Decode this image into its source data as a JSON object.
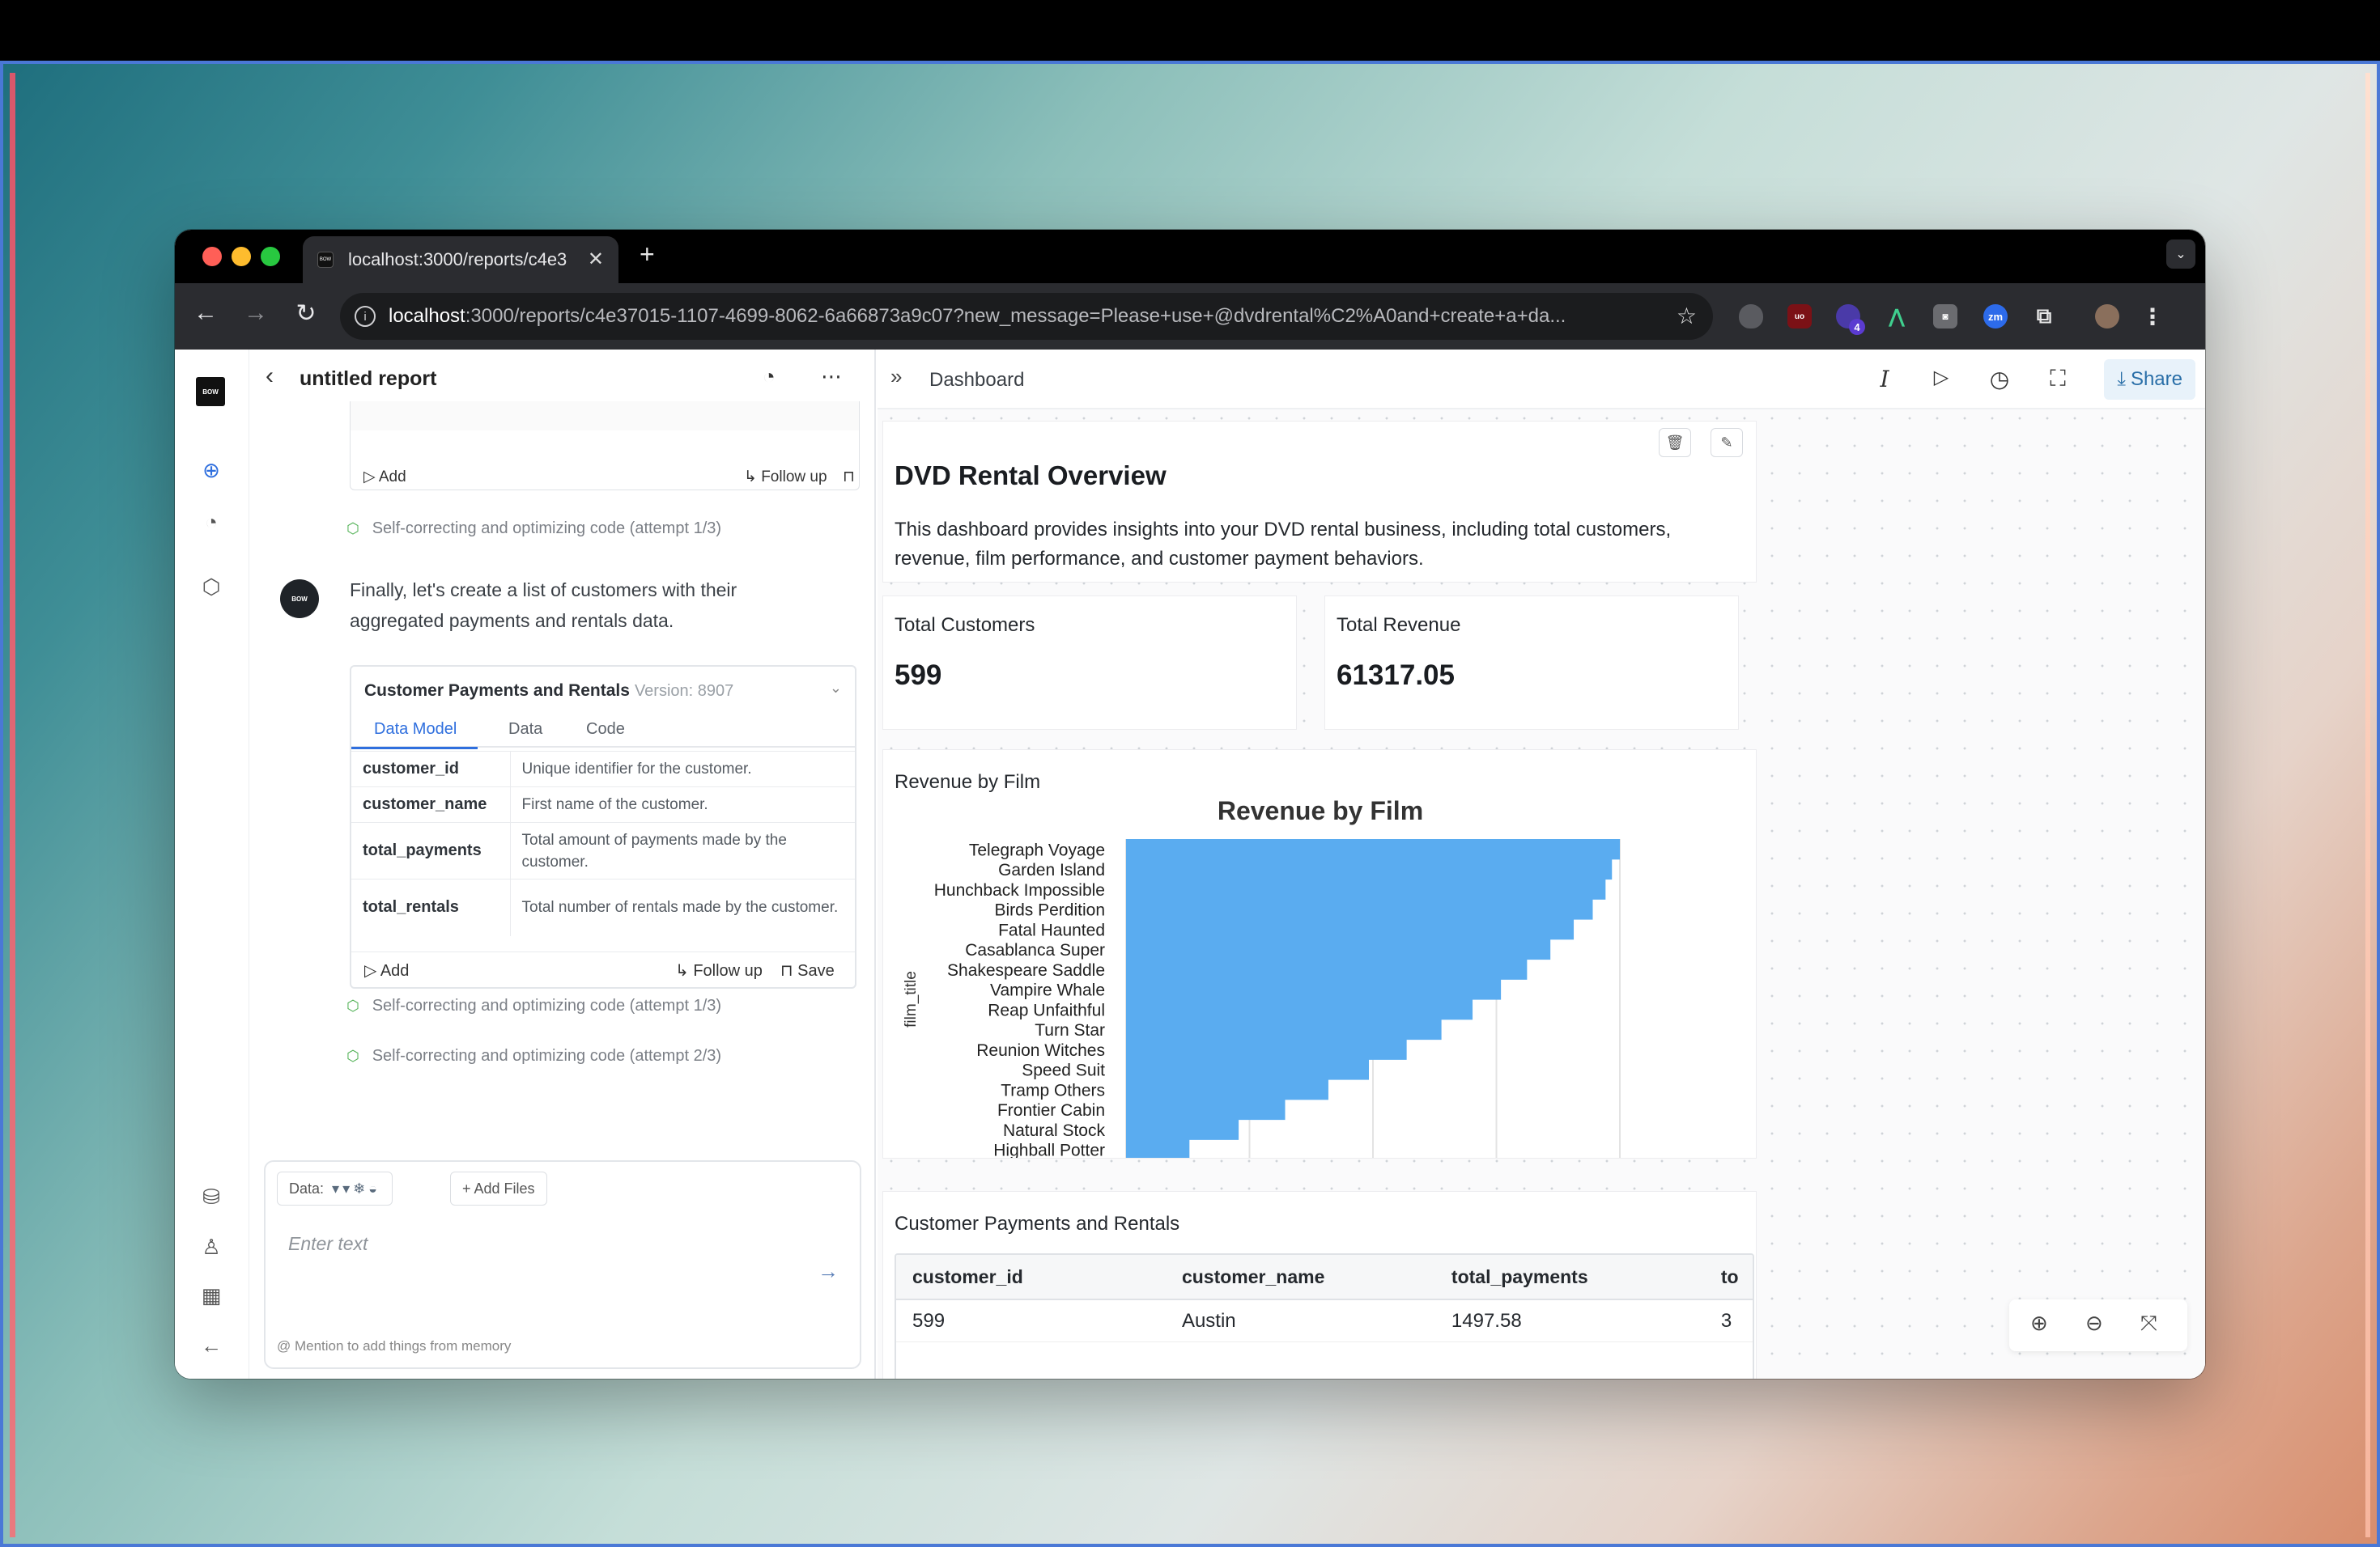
{
  "browser": {
    "tab_title": "localhost:3000/reports/c4e3",
    "url_host": "localhost",
    "url_rest": ":3000/reports/c4e37015-1107-4699-8062-6a66873a9c07?new_message=Please+use+@dvdrental%C2%A0and+create+a+da...",
    "extension_badge": "4"
  },
  "brand": {
    "logo_text": "BOW"
  },
  "chat": {
    "title": "untitled report",
    "top_card": {
      "add_label": "Add",
      "follow_label": "Follow up"
    },
    "status_1": "Self-correcting and optimizing code (attempt 1/3)",
    "assistant_avatar": "BOW",
    "message": "Finally, let's create a list of customers with their aggregated payments and rentals data.",
    "data_model": {
      "title": "Customer Payments and Rentals",
      "version": "Version: 8907",
      "tabs": [
        "Data Model",
        "Data",
        "Code"
      ],
      "fields": [
        {
          "name": "customer_id",
          "desc": "Unique identifier for the customer."
        },
        {
          "name": "customer_name",
          "desc": "First name of the customer."
        },
        {
          "name": "total_payments",
          "desc": "Total amount of payments made by the customer."
        },
        {
          "name": "total_rentals",
          "desc": "Total number of rentals made by the customer."
        }
      ],
      "add_label": "Add",
      "follow_label": "Follow up",
      "save_label": "Save"
    },
    "status_2": "Self-correcting and optimizing code (attempt 1/3)",
    "status_3": "Self-correcting and optimizing code (attempt 2/3)",
    "composer": {
      "data_label": "Data:",
      "add_files_label": "+ Add Files",
      "placeholder": "Enter text",
      "hint": "@ Mention to add things from memory"
    }
  },
  "dashboard": {
    "header_title": "Dashboard",
    "share_label": "Share",
    "overview": {
      "title": "DVD Rental Overview",
      "description": "This dashboard provides insights into your DVD rental business, including total customers, revenue, film performance, and customer payment behaviors."
    },
    "kpis": [
      {
        "label": "Total Customers",
        "value": "599"
      },
      {
        "label": "Total Revenue",
        "value": "61317.05"
      }
    ],
    "chart_panel_title": "Revenue by Film",
    "table": {
      "title": "Customer Payments and Rentals",
      "columns": [
        "customer_id",
        "customer_name",
        "total_payments",
        "to"
      ],
      "rows": [
        [
          "599",
          "Austin",
          "1497.58",
          "3"
        ]
      ]
    }
  },
  "chart_data": {
    "type": "bar",
    "orientation": "horizontal",
    "title": "Revenue by Film",
    "ylabel": "film_title",
    "xlabel": "",
    "categories": [
      "Telegraph Voyage",
      "Garden Island",
      "Hunchback Impossible",
      "Birds Perdition",
      "Fatal Haunted",
      "Casablanca Super",
      "Shakespeare Saddle",
      "Vampire Whale",
      "Reap Unfaithful",
      "Turn Star",
      "Reunion Witches",
      "Speed Suit",
      "Tramp Others",
      "Frontier Cabin",
      "Natural Stock",
      "Highball Potter"
    ],
    "values": [
      215.75,
      212.3,
      209.5,
      203.9,
      195.6,
      185.4,
      175.2,
      163.8,
      151.4,
      137.8,
      122.6,
      106.1,
      88.4,
      69.5,
      49.2,
      27.7
    ],
    "grid": true,
    "color": "#5aacf0"
  }
}
